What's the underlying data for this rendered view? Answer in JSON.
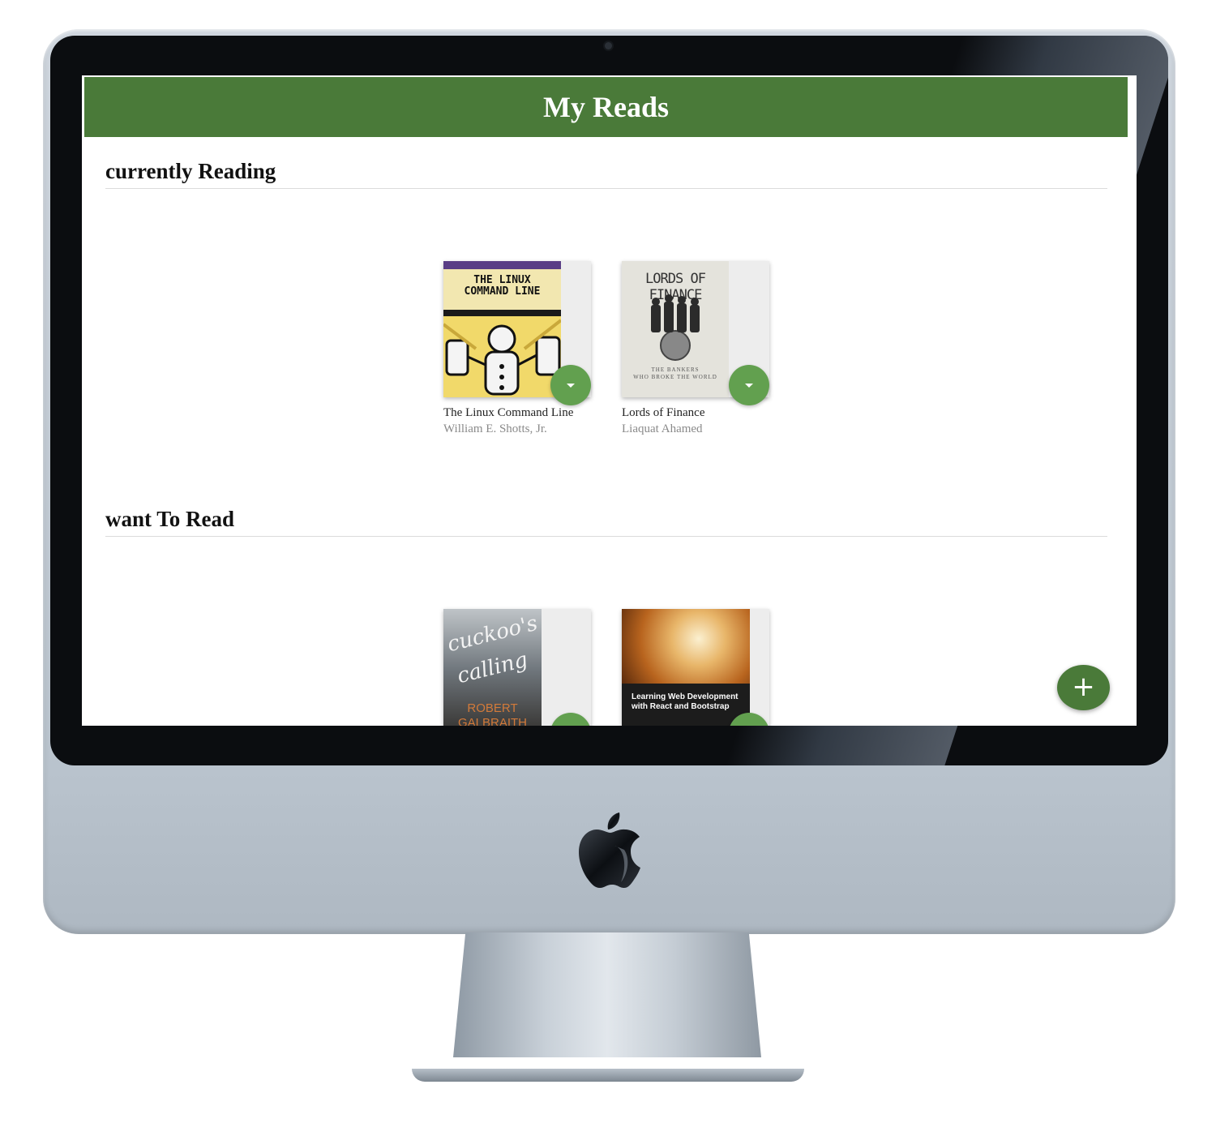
{
  "app": {
    "title": "My Reads"
  },
  "shelves": [
    {
      "title": "currently Reading",
      "books": [
        {
          "title": "The Linux Command Line",
          "author": "William E. Shotts, Jr.",
          "cover": {
            "line1": "THE LINUX",
            "line2": "COMMAND LINE"
          }
        },
        {
          "title": "Lords of Finance",
          "author": "Liaquat Ahamed",
          "cover": {
            "line1": "LORDS OF FINANCE",
            "line2": "THE BANKERS",
            "line3": "WHO BROKE THE WORLD"
          }
        }
      ]
    },
    {
      "title": "want To Read",
      "books": [
        {
          "title": "",
          "author": "",
          "cover": {
            "line1": "cuckoo's",
            "line2": "calling",
            "line3": "ROBERT",
            "line4": "GALBRAITH"
          }
        },
        {
          "title": "",
          "author": "",
          "cover": {
            "line1": "Learning Web Development",
            "line2": "with React and Bootstrap"
          }
        }
      ]
    }
  ],
  "fab": {
    "symbol": "+"
  },
  "icons": {
    "shelf_changer": "caret-down-icon",
    "fab": "plus-icon",
    "camera": "camera-icon",
    "brand": "apple-logo-icon"
  },
  "colors": {
    "header": "#4a7a39",
    "shelf_changer": "#62a04f",
    "fab": "#4a7a39"
  }
}
